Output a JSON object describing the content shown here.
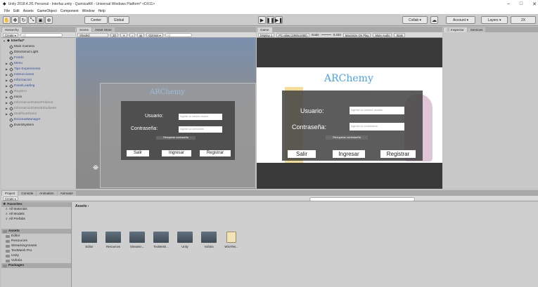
{
  "window": {
    "title": "Unity 2018.4.2f1 Personal - Interfaz.unity - QuimicaAR - Universal Windows Platform* <DX11>",
    "controls": [
      "–",
      "□",
      "✕"
    ]
  },
  "menu": [
    "File",
    "Edit",
    "Assets",
    "GameObject",
    "Component",
    "Window",
    "Help"
  ],
  "toolbar": {
    "center_label": "Center",
    "global_label": "Global",
    "collab_label": "Collab ▾",
    "account_label": "Account ▾",
    "layers_label": "Layers ▾",
    "layout_label": "2X"
  },
  "hierarchy": {
    "tab": "Hierarchy",
    "create_label": "Create ▾",
    "search_placeholder": "All",
    "scene_name": "Interfaz*",
    "items": [
      "Main Camera",
      "Directional Light",
      "Fondo",
      "Menu",
      "Tipo Experimento",
      "Instrucciones",
      "Informacion",
      "PanelLoading",
      "Registro",
      "Inicio",
      "InformacionDatosProfesor",
      "InformacionDatosEstudiante",
      "ModificarDatos",
      "EscenasManager",
      "EventSystem"
    ]
  },
  "scene": {
    "tabs": [
      "Scene",
      "Asset Store"
    ],
    "shading": "Shaded",
    "mode_2d": "2D",
    "gizmos": "Gizmos ▾",
    "search_placeholder": "All"
  },
  "game": {
    "tab": "Game",
    "display": "Display 1",
    "resolution": "PC-alias (1980x1080)",
    "scale_label": "Scale",
    "scale_value": "0.333",
    "options": [
      "Maximize On Play",
      "Mute Audio",
      "Stats",
      "Gizmos"
    ]
  },
  "inspector": {
    "tabs": [
      "Inspector",
      "Services"
    ]
  },
  "login": {
    "title": "ARChemy",
    "user_label": "Usuario:",
    "user_placeholder": "Ingrese su nombre usuario",
    "password_label": "Contraseña:",
    "password_placeholder": "Ingrese su contraseña",
    "recover_label": "Recuperar contraseña",
    "buttons": {
      "exit": "Salir",
      "login": "Ingresar",
      "register": "Registrar"
    }
  },
  "project": {
    "tabs": [
      "Project",
      "Console",
      "Animation",
      "Animator"
    ],
    "create_label": "Create ▾",
    "favorites_header": "Favorites",
    "favorites": [
      "All Materials",
      "All Models",
      "All Prefabs"
    ],
    "assets_header": "Assets",
    "asset_folders_tree": [
      "Editor",
      "Resources",
      "StreamingAssets",
      "TextMesh Pro",
      "Unity",
      "Vuforia"
    ],
    "packages_header": "Packages",
    "breadcrumb": "Assets ›",
    "asset_items": [
      "Editor",
      "Resources",
      "Streamin...",
      "TextMesh...",
      "Unity",
      "Vuforia",
      "WSATes..."
    ]
  },
  "colors": {
    "selection": "#3a72c9",
    "panel": "#464646",
    "chemy": "#4aa3e8"
  }
}
